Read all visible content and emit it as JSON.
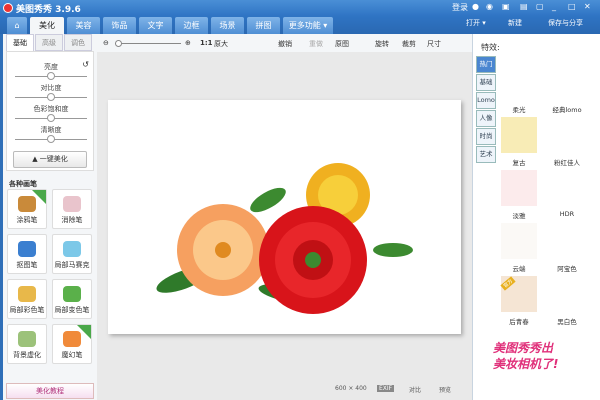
{
  "title": "美图秀秀 3.9.6",
  "titlebar": {
    "login": "登录"
  },
  "tabs": [
    "美化",
    "美容",
    "饰品",
    "文字",
    "边框",
    "场景",
    "拼图",
    "更多功能 ▾"
  ],
  "top_actions": {
    "open": "打开 ▾",
    "new": "新建",
    "save": "保存与分享"
  },
  "toolbar": {
    "ratio": "1:1",
    "original": "原大",
    "undo": "撤销",
    "redo": "重做",
    "original_img": "原图",
    "rotate": "旋转",
    "crop": "裁剪",
    "resize": "尺寸"
  },
  "left": {
    "subtabs": [
      "基础",
      "高级",
      "调色"
    ],
    "sliders": [
      {
        "label": "亮度",
        "value": 0.5
      },
      {
        "label": "对比度",
        "value": 0.5
      },
      {
        "label": "色彩饱和度",
        "value": 0.5
      },
      {
        "label": "清晰度",
        "value": 0.5
      }
    ],
    "one_key": "一键美化",
    "brush_title": "各种画笔",
    "brushes": [
      {
        "label": "涂鸦笔",
        "badge": "热"
      },
      {
        "label": "消除笔"
      },
      {
        "label": "抠图笔"
      },
      {
        "label": "局部马赛克"
      },
      {
        "label": "局部彩色笔"
      },
      {
        "label": "局部变色笔"
      },
      {
        "label": "背景虚化"
      },
      {
        "label": "魔幻笔",
        "badge": "new"
      }
    ],
    "tutorial": "美化教程"
  },
  "status": {
    "size": "600 × 400",
    "exif": "EXIF",
    "compare": "对比",
    "preview": "预览"
  },
  "right": {
    "title": "特效:",
    "tabs": [
      "热门",
      "基础",
      "Lomo",
      "人像",
      "时尚",
      "艺术"
    ],
    "effects": [
      "柔光",
      "经典lomo",
      "复古",
      "粉红佳人",
      "淡雅",
      "HDR",
      "云端",
      "阿宝色",
      "后青春",
      "黑白色"
    ],
    "badge": "官方",
    "promo": [
      "美图秀秀出",
      "美妆相机了!"
    ]
  }
}
